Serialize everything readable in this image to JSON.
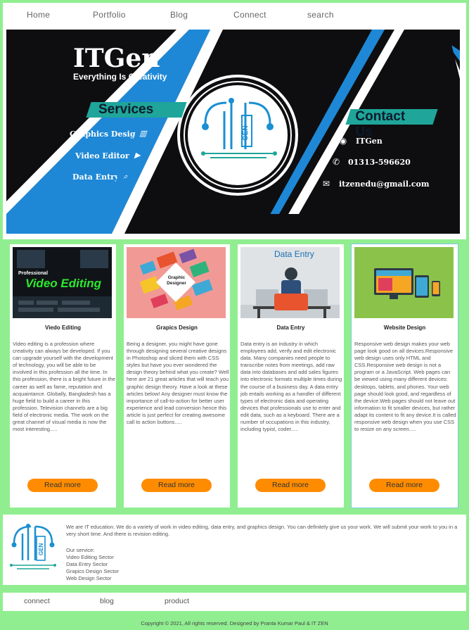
{
  "nav": {
    "home": "Home",
    "portfolio": "Portfolio",
    "blog": "Blog",
    "connect": "Connect",
    "search": "search"
  },
  "banner": {
    "brand": "ITGen",
    "tagline": "Everything Is Creativity",
    "services_heading": "Services",
    "services": [
      {
        "label": "Graphics Design",
        "icon": "chart-icon"
      },
      {
        "label": "Video Editor",
        "icon": "video-icon"
      },
      {
        "label": "Data Entry",
        "icon": "search-icon"
      }
    ],
    "contact_heading": "Contact Us",
    "contacts": [
      {
        "label": "ITGen",
        "icon": "messenger-icon"
      },
      {
        "label": "01313-596620",
        "icon": "whatsapp-icon"
      },
      {
        "label": "itzenedu@gmail.com",
        "icon": "mail-icon"
      }
    ],
    "logo_text": "GEN"
  },
  "cards": [
    {
      "title": "Viedo Editing",
      "image_text": "Video Editing",
      "image_caption": "Professional",
      "text": "Video editing is a profession where creativity can always be developed. If you can upgrade yourself with the development of technology, you will be able to be involved in this profession all the time. In this profession, there is a bright future in the career as well as fame, reputation and acquaintance. Globally, Bangladesh has a huge field to build a career in this profession. Television channels are a big field of electronic media. The work on the great channel of visual media is now the most interesting.....",
      "button": "Read more"
    },
    {
      "title": "Grapics Design",
      "image_text": "Graphic Designer",
      "text": "Being a designer, you might have gone through designing several creative designs in Photoshop and sliced them with CSS styles but have you ever wondered the design theory behind what you create? Well here are 21 great articles that will teach you graphic design theory. Have a look at these articles below! Any designer must know the importance of call-to-action for better user experience and lead conversion hence this article is just perfect for creating awesome call to action buttons.....",
      "button": "Read more"
    },
    {
      "title": "Data Entry",
      "image_text": "Data Entry",
      "text": "Data entry is an industry in which employees add, verify and edit electronic data. Many companies need people to transcribe notes from meetings, add raw data into databases and add sales figures into electronic formats multiple times during the course of a business day. A data entry job entails working as a handler of different types of electronic data and operating devices that professionals use to enter and edit data, such as a keyboard. There are a number of occupations in this industry, including typist, coder.....",
      "button": "Read more"
    },
    {
      "title": "Website Design",
      "text": "Responsive web design makes your web page look good on all devices.Responsive web design uses only HTML and CSS.Responsive web design is not a program or a JavaScript. Web pages can be viewed using many different devices: desktops, tablets, and phones. Your web page should look good, and regardless of the device.Web pages should not leave out information to fit smaller devices, but rather adapt its content to fit any device.It is called responsive web design when you use CSS to resize on any screen.....",
      "button": "Read more"
    }
  ],
  "about": {
    "text": "We are IT education. We do a variety of work in video editing, data entry, and graphics design. You can definitely give us your work. We will submit your work to you in a very short time. And there is revision editing.",
    "services_heading": "Our service:",
    "services": [
      "Video Editing Sector",
      "Data Entry Sector",
      "Grapics Design Sector",
      "Web Design Sector"
    ],
    "logo_text": "GEN"
  },
  "footer": {
    "connect": "connect",
    "blog": "blog",
    "product": "product",
    "copyright": "Copyright © 2021, All rights reserved. Designed by Pranta Kumar Paul & IT ZEN"
  },
  "colors": {
    "page_bg": "#90ee90",
    "button": "#ff8c00",
    "banner_blue": "#1e88d6",
    "banner_teal": "#1fa59a"
  }
}
